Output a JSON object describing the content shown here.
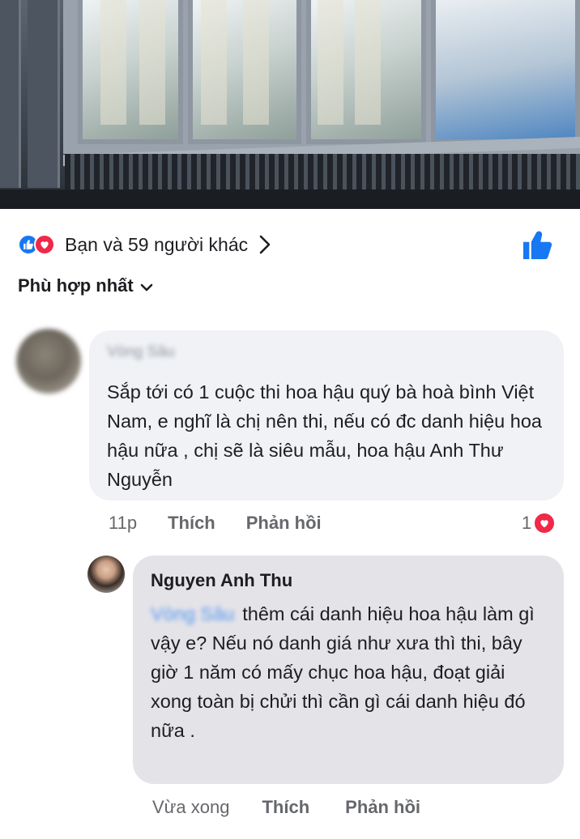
{
  "reactions": {
    "summary": "Bạn và 59 người khác",
    "icons": [
      "like-icon",
      "love-icon"
    ]
  },
  "sort": {
    "label": "Phù hợp nhất"
  },
  "comment": {
    "author": "Vòng Sâu",
    "text": "Sắp tới có 1 cuộc thi hoa hậu quý bà hoà bình Việt Nam, e nghĩ là chị nên thi, nếu có đc danh hiệu hoa hậu nữa , chị sẽ là siêu mẫu, hoa hậu Anh Thư Nguyễn",
    "time": "11p",
    "like_label": "Thích",
    "reply_label": "Phản hồi",
    "reaction_count": "1"
  },
  "reply": {
    "author": "Nguyen Anh Thu",
    "mention": "Vòng Sâu",
    "text": "thêm cái danh hiệu hoa hậu làm gì vậy e? Nếu nó danh giá như xưa thì thi, bây giờ 1 năm có mấy chục hoa hậu, đoạt giải xong toàn bị chửi thì cần gì cái danh hiệu đó nữa .",
    "time": "Vừa xong",
    "like_label": "Thích",
    "reply_label": "Phản hồi"
  },
  "colors": {
    "like_blue": "#1877f2",
    "love_red": "#f02849",
    "bubble_bg": "#f0f2f5",
    "meta_gray": "#65676b"
  }
}
